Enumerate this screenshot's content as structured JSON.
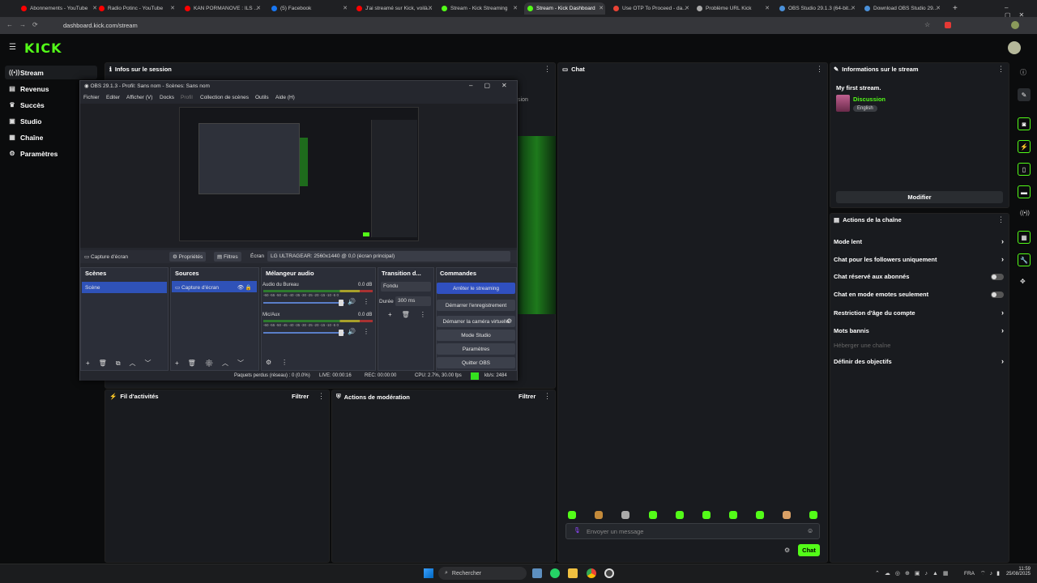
{
  "browser": {
    "tabs": [
      {
        "label": "Abonnements - YouTube",
        "color": "#ff0000"
      },
      {
        "label": "Radio Potinc - YouTube",
        "color": "#ff0000"
      },
      {
        "label": "KAN PORMANOVE : ILS ...",
        "color": "#ff0000"
      },
      {
        "label": "(5) Facebook",
        "color": "#1877f2"
      },
      {
        "label": "J'ai streamé sur Kick, voilà...",
        "color": "#ff0000"
      },
      {
        "label": "Stream - Kick Streaming",
        "color": "#53fc18"
      },
      {
        "label": "Stream - Kick Dashboard",
        "color": "#53fc18"
      },
      {
        "label": "Use OTP To Proceed - da...",
        "color": "#ea4335"
      },
      {
        "label": "Problème URL Kick",
        "color": "#aaaaaa"
      },
      {
        "label": "OBS Studio 29.1.3 (64-bit...",
        "color": "#4a90d9"
      },
      {
        "label": "Download OBS Studio 29...",
        "color": "#4a90d9"
      }
    ],
    "url": "dashboard.kick.com/stream"
  },
  "kick": {
    "logo": "KICK",
    "nav": [
      {
        "label": "Stream",
        "icon": "((•))"
      },
      {
        "label": "Revenus",
        "icon": "▤"
      },
      {
        "label": "Succès",
        "icon": "♛"
      },
      {
        "label": "Studio",
        "icon": "▣"
      },
      {
        "label": "Chaîne",
        "icon": "▦"
      },
      {
        "label": "Paramètres",
        "icon": "⚙"
      }
    ],
    "session_title": "Infos sur le session",
    "chat_title": "Chat",
    "activity_title": "Fil d'activités",
    "activity_filter": "Filtrer",
    "moderation_title": "Actions de modération",
    "moderation_filter": "Filtrer",
    "partial_text": "sion",
    "stream_info": {
      "title": "Informations sur le stream",
      "stream_name": "My first stream.",
      "category": "Discussion",
      "language": "English",
      "edit_button": "Modifier"
    },
    "channel_actions": {
      "title": "Actions de la chaîne",
      "items": [
        {
          "label": "Mode lent",
          "type": "arrow"
        },
        {
          "label": "Chat pour les followers uniquement",
          "type": "arrow"
        },
        {
          "label": "Chat réservé aux abonnés",
          "type": "toggle"
        },
        {
          "label": "Chat en mode emotes seulement",
          "type": "toggle"
        },
        {
          "label": "Restriction d'âge du compte",
          "type": "arrow"
        },
        {
          "label": "Mots bannis",
          "type": "arrow"
        },
        {
          "label": "Héberger une chaîne",
          "type": "disabled"
        },
        {
          "label": "Définir des objectifs",
          "type": "arrow"
        }
      ]
    },
    "chat_input_placeholder": "Envoyer un message",
    "chat_button": "Chat"
  },
  "obs": {
    "title": "OBS 29.1.3 - Profil: Sans nom - Scènes: Sans nom",
    "menu": [
      "Fichier",
      "Editer",
      "Afficher (V)",
      "Docks",
      "Profil",
      "Collection de scènes",
      "Outils",
      "Aide (H)"
    ],
    "source_bar": {
      "capture": "Capture d'écran",
      "properties": "Propriétés",
      "filters": "Filtres",
      "screen_label": "Écran",
      "screen_value": "LG ULTRAGEAR: 2560x1440 @ 0,0 (écran principal)"
    },
    "scenes_title": "Scènes",
    "scenes": [
      "Scène"
    ],
    "sources_title": "Sources",
    "sources": [
      "Capture d'écran"
    ],
    "mixer_title": "Mélangeur audio",
    "mixer": [
      {
        "name": "Audio du Bureau",
        "db": "0.0 dB"
      },
      {
        "name": "Mic/Aux",
        "db": "0.0 dB"
      }
    ],
    "mixer_ticks": "-60 -55 -50 -45 -40 -35 -30 -25 -20 -15 -10 -5 0",
    "transition_title": "Transition d...",
    "transition_value": "Fondu",
    "duration_label": "Durée",
    "duration_value": "300 ms",
    "controls_title": "Commandes",
    "controls": [
      "Arrêter le streaming",
      "Démarrer l'enregistrement",
      "Démarrer la caméra virtuelle",
      "Mode Studio",
      "Paramètres",
      "Quitter OBS"
    ],
    "status": {
      "dropped": "Paquets perdus (réseau) : 0 (0.0%)",
      "live": "LIVE: 00:00:16",
      "rec": "REC: 00:00:00",
      "cpu": "CPU: 2.7%, 30.00 fps",
      "kbs": "kb/s: 2484"
    }
  },
  "taskbar": {
    "search": "Rechercher",
    "lang": "FRA",
    "time": "11:59",
    "date": "25/08/2025"
  }
}
